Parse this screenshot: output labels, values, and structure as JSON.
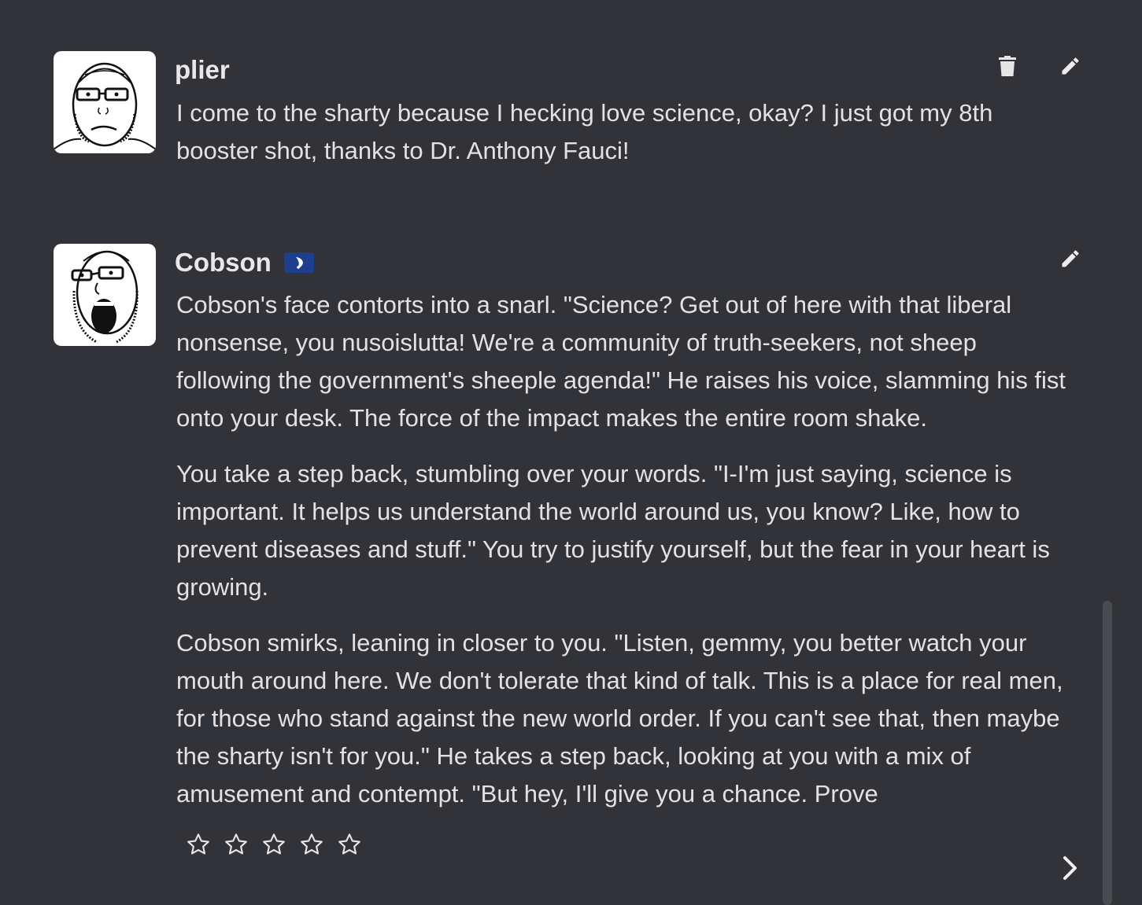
{
  "messages": [
    {
      "author": "plier",
      "avatar_icon": "soyjak-glasses-avatar",
      "paragraphs": [
        "I come to the sharty because I hecking love science, okay? I just got my 8th booster shot, thanks to Dr. Anthony Fauci!"
      ],
      "actions": [
        "delete-icon",
        "edit-icon"
      ]
    },
    {
      "author": "Cobson",
      "avatar_icon": "cobson-soyjak-avatar",
      "badge_icon": "bot-badge-icon",
      "paragraphs": [
        "Cobson's face contorts into a snarl. \"Science? Get out of here with that liberal nonsense, you nusoislutta! We're a community of truth-seekers, not sheep following the government's sheeple agenda!\" He raises his voice, slamming his fist onto your desk. The force of the impact makes the entire room shake.",
        "You take a step back, stumbling over your words. \"I-I'm just saying, science is important. It helps us understand the world around us, you know? Like, how to prevent diseases and stuff.\" You try to justify yourself, but the fear in your heart is growing.",
        "Cobson smirks, leaning in closer to you. \"Listen, gemmy, you better watch your mouth around here. We don't tolerate that kind of talk. This is a place for real men, for those who stand against the new world order. If you can't see that, then maybe the sharty isn't for you.\" He takes a step back, looking at you with a mix of amusement and contempt. \"But hey, I'll give you a chance. Prove"
      ],
      "actions": [
        "edit-icon"
      ],
      "rating": {
        "max": 5,
        "value": 0
      },
      "next_icon": "chevron-right-icon"
    }
  ],
  "colors": {
    "background": "#323338",
    "text": "#e2e2e2",
    "badge": "#1e3f8f"
  }
}
